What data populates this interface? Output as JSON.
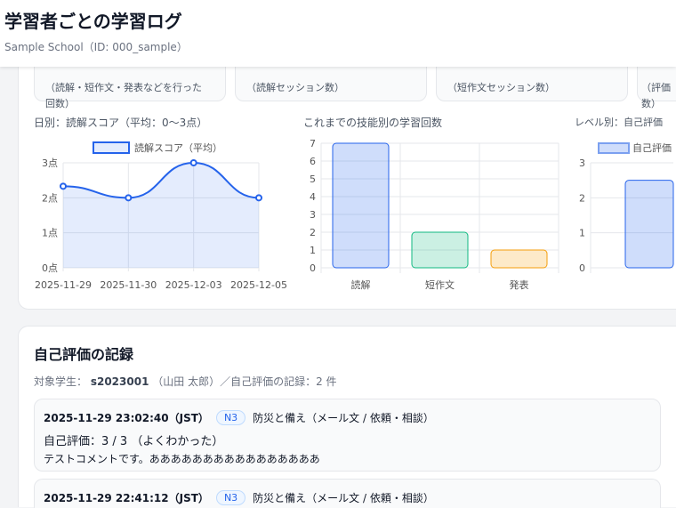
{
  "header": {
    "title": "学習者ごとの学習ログ",
    "subtitle": "Sample School（ID: 000_sample）"
  },
  "stats": [
    {
      "desc1": "（読解・短作文・発表などを行った",
      "desc2": "回数）"
    },
    {
      "desc1": "（読解セッション数）",
      "desc2": ""
    },
    {
      "desc1": "（短作文セッション数）",
      "desc2": ""
    },
    {
      "desc1": "（評価",
      "desc2": "数）"
    }
  ],
  "chart_data": [
    {
      "type": "line",
      "title": "日別：読解スコア（平均：0〜3点）",
      "legend": "読解スコア（平均）",
      "categories": [
        "2025-11-29",
        "2025-11-30",
        "2025-12-03",
        "2025-12-05"
      ],
      "values": [
        2.33,
        2.0,
        3.0,
        2.0
      ],
      "yticks": [
        "0点",
        "1点",
        "2点",
        "3点"
      ],
      "ylim": [
        0,
        3
      ],
      "color": "#2563eb"
    },
    {
      "type": "bar",
      "title": "これまでの技能別の学習回数",
      "categories": [
        "読解",
        "短作文",
        "発表"
      ],
      "values": [
        7,
        2,
        1
      ],
      "yticks": [
        "0",
        "1",
        "2",
        "3",
        "4",
        "5",
        "6",
        "7"
      ],
      "ylim": [
        0,
        7
      ],
      "colors": [
        "#2563eb",
        "#10b981",
        "#f59e0b"
      ]
    },
    {
      "type": "bar",
      "title": "レベル別：自己評価",
      "legend": "自己評価",
      "values": [
        2.5
      ],
      "yticks": [
        "0",
        "1",
        "2",
        "3"
      ],
      "ylim": [
        0,
        3
      ],
      "color": "#2563eb"
    }
  ],
  "selfeval": {
    "title": "自己評価の記録",
    "meta_prefix": "対象学生：",
    "student_id": "s2023001",
    "meta_suffix": "（山田 太郎）／自己評価の記録：2 件",
    "entries": [
      {
        "time": "2025-11-29 23:02:40（JST）",
        "level": "N3",
        "topic": "防災と備え（メール文 / 依頼・相談）",
        "score": "自己評価：3 / 3 （よくわかった）",
        "comment": "テストコメントです。ああああああああああああああああ"
      },
      {
        "time": "2025-11-29 22:41:12（JST）",
        "level": "N3",
        "topic": "防災と備え（メール文 / 依頼・相談）"
      }
    ]
  }
}
